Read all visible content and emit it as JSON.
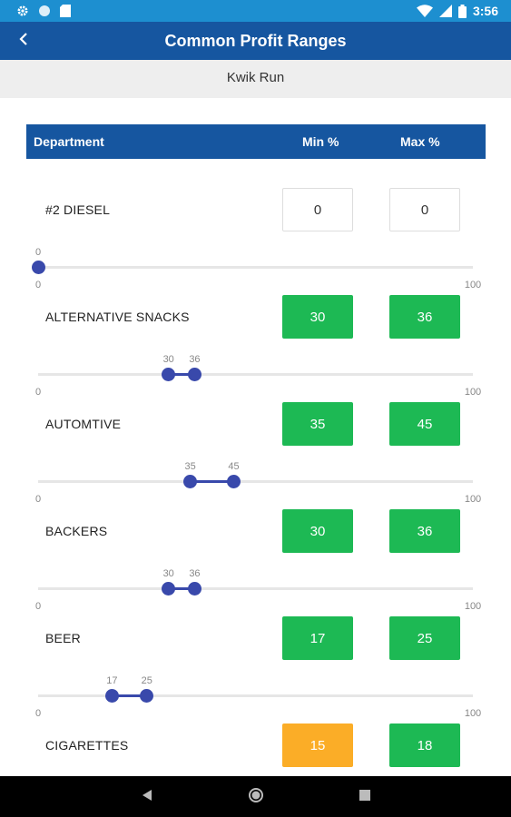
{
  "status_bar": {
    "time": "3:56",
    "left_icons": [
      "gear-icon",
      "circle-icon",
      "sd-card-icon"
    ],
    "right_icons": [
      "wifi-icon",
      "signal-icon",
      "battery-icon"
    ]
  },
  "app_bar": {
    "title": "Common Profit Ranges",
    "back_icon": "chevron-left-icon"
  },
  "store": {
    "name": "Kwik Run"
  },
  "table": {
    "headers": {
      "department": "Department",
      "min": "Min %",
      "max": "Max %"
    }
  },
  "colors": {
    "status_bar": "#1d8fd0",
    "app_bar": "#1656a0",
    "good": "#1db954",
    "warning": "#fbad27",
    "slider": "#3949ab"
  },
  "slider_scale": {
    "min_label": "0",
    "max_label": "100",
    "min": 0,
    "max": 100
  },
  "departments": [
    {
      "name": "#2 DIESEL",
      "min": "0",
      "max": "0",
      "min_status": "neutral",
      "max_status": "neutral"
    },
    {
      "name": "ALTERNATIVE SNACKS",
      "min": "30",
      "max": "36",
      "min_status": "good",
      "max_status": "good"
    },
    {
      "name": "AUTOMTIVE",
      "min": "35",
      "max": "45",
      "min_status": "good",
      "max_status": "good"
    },
    {
      "name": "BACKERS",
      "min": "30",
      "max": "36",
      "min_status": "good",
      "max_status": "good"
    },
    {
      "name": "BEER",
      "min": "17",
      "max": "25",
      "min_status": "good",
      "max_status": "good"
    },
    {
      "name": "CIGARETTES",
      "min": "15",
      "max": "18",
      "min_status": "warning",
      "max_status": "good"
    }
  ],
  "nav_bar": {
    "buttons": [
      "back-triangle-icon",
      "home-circle-icon",
      "recents-square-icon"
    ]
  }
}
